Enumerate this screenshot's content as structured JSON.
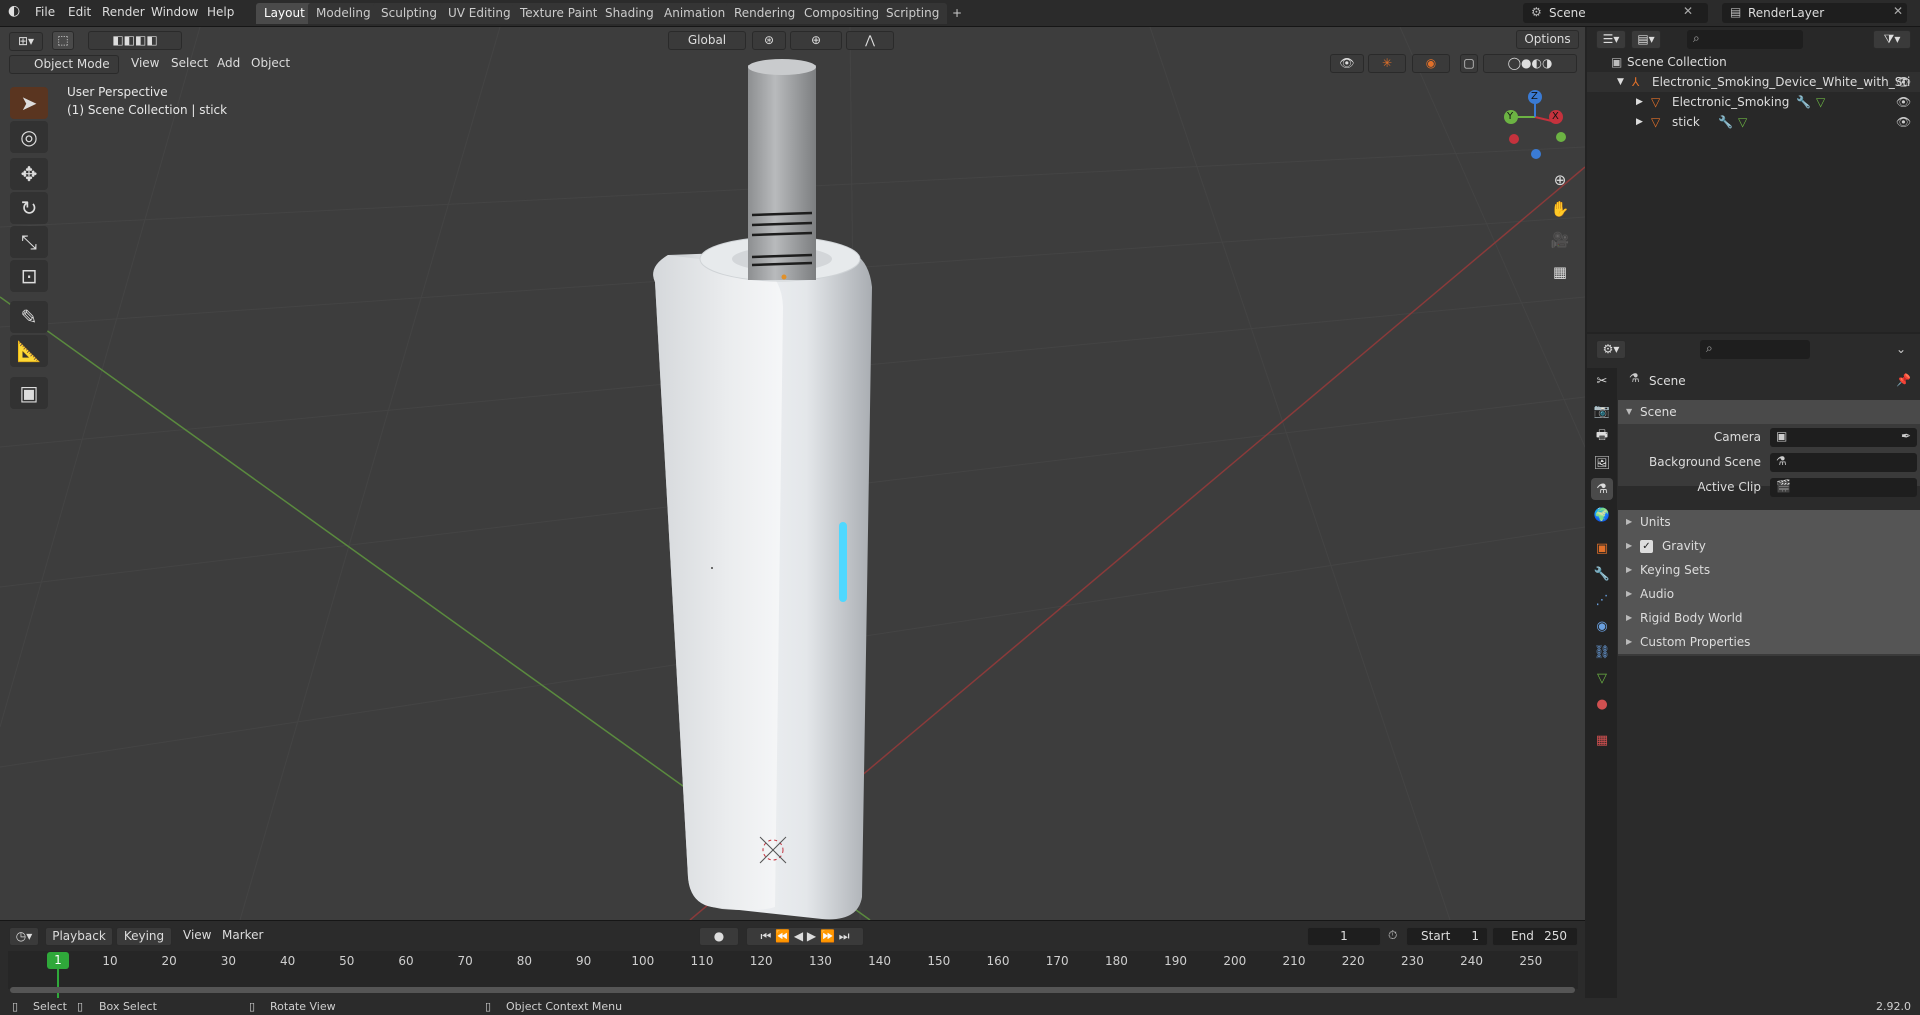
{
  "topbar": {
    "menus": [
      "File",
      "Edit",
      "Render",
      "Window",
      "Help"
    ],
    "workspaces": [
      "Layout",
      "Modeling",
      "Sculpting",
      "UV Editing",
      "Texture Paint",
      "Shading",
      "Animation",
      "Rendering",
      "Compositing",
      "Scripting"
    ],
    "active_workspace": "Layout",
    "add_tab": "+",
    "scene": "Scene",
    "view_layer": "RenderLayer"
  },
  "viewport": {
    "mode": "Object Mode",
    "menus": [
      "View",
      "Select",
      "Add",
      "Object"
    ],
    "transform_orientation": "Global",
    "options": "Options",
    "perspective_label": "User Perspective",
    "collection_label": "(1) Scene Collection | stick",
    "axes": {
      "x": "X",
      "y": "Y",
      "z": "Z"
    }
  },
  "timeline": {
    "playback": "Playback",
    "keying": "Keying",
    "menus": [
      "View",
      "Marker"
    ],
    "current_frame": "1",
    "start_label": "Start",
    "start": "1",
    "end_label": "End",
    "end": "250",
    "frame_marker": "1",
    "frame_ticks": [
      "10",
      "20",
      "30",
      "40",
      "50",
      "60",
      "70",
      "80",
      "90",
      "100",
      "110",
      "120",
      "130",
      "140",
      "150",
      "160",
      "170",
      "180",
      "190",
      "200",
      "210",
      "220",
      "230",
      "240",
      "250"
    ]
  },
  "statusbar": {
    "select": "Select",
    "box_select": "Box Select",
    "rotate": "Rotate View",
    "context_menu": "Object Context Menu",
    "version": "2.92.0"
  },
  "outliner": {
    "root": "Scene Collection",
    "items": [
      {
        "label": "Electronic_Smoking_Device_White_with_Sti"
      },
      {
        "label": "Electronic_Smoking"
      },
      {
        "label": "stick"
      }
    ]
  },
  "properties": {
    "context": "Scene",
    "panel_title": "Scene",
    "fields": [
      {
        "label": "Camera"
      },
      {
        "label": "Background Scene"
      },
      {
        "label": "Active Clip"
      }
    ],
    "subpanels": [
      "Units",
      "Gravity",
      "Keying Sets",
      "Audio",
      "Rigid Body World",
      "Custom Properties"
    ]
  },
  "colors": {
    "accent": "#e0702a",
    "active_workspace": "#4a4a4a",
    "frame_marker": "#2fa83a",
    "x_axis": "#c5323d",
    "y_axis": "#6cb343",
    "z_axis": "#3a7bd5",
    "led": "#4fd8ff"
  }
}
